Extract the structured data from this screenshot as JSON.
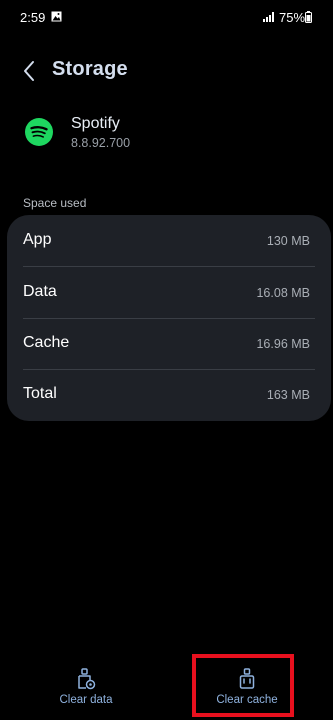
{
  "status_bar": {
    "time": "2:59",
    "battery": "75%"
  },
  "header": {
    "title": "Storage"
  },
  "app": {
    "name": "Spotify",
    "version": "8.8.92.700",
    "icon": "spotify-logo"
  },
  "storage": {
    "section_label": "Space used",
    "rows": [
      {
        "label": "App",
        "value": "130 MB"
      },
      {
        "label": "Data",
        "value": "16.08 MB"
      },
      {
        "label": "Cache",
        "value": "16.96 MB"
      },
      {
        "label": "Total",
        "value": "163 MB"
      }
    ]
  },
  "actions": {
    "clear_data": "Clear data",
    "clear_cache": "Clear cache"
  },
  "colors": {
    "spotify_green": "#1ed760",
    "accent_blue": "#8fb2de",
    "highlight_red": "#e8101e",
    "card_bg": "#1e2127"
  }
}
